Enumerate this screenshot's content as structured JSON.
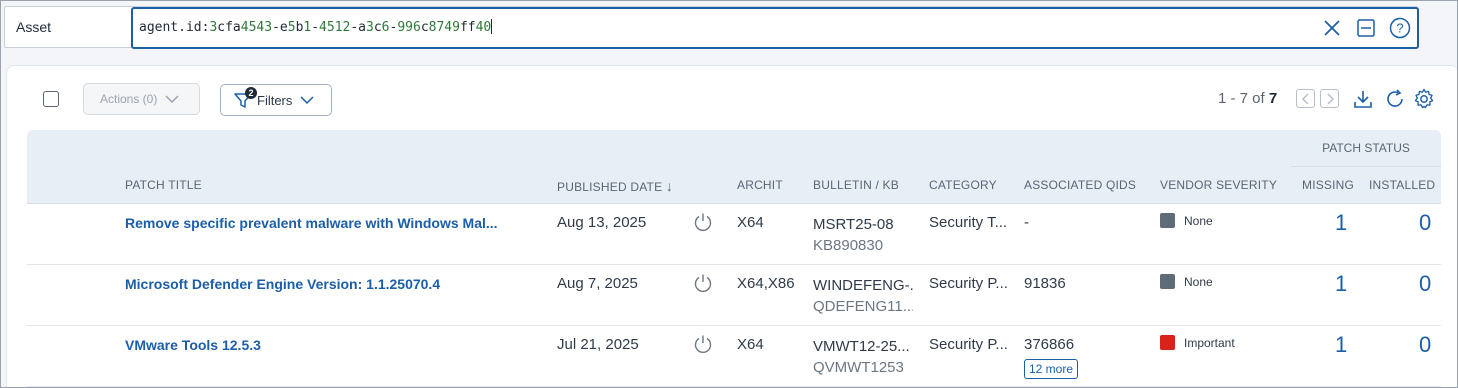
{
  "search": {
    "label": "Asset",
    "query_key": "agent.id:",
    "query_parts": [
      {
        "t": "3",
        "n": true
      },
      {
        "t": "cfa",
        "n": false
      },
      {
        "t": "4543",
        "n": true
      },
      {
        "t": "-e",
        "n": false
      },
      {
        "t": "5",
        "n": true
      },
      {
        "t": "b",
        "n": false
      },
      {
        "t": "1",
        "n": true
      },
      {
        "t": "-",
        "n": false
      },
      {
        "t": "4512",
        "n": true
      },
      {
        "t": "-a",
        "n": false
      },
      {
        "t": "3",
        "n": true
      },
      {
        "t": "c",
        "n": false
      },
      {
        "t": "6",
        "n": true
      },
      {
        "t": "-",
        "n": false
      },
      {
        "t": "996",
        "n": true
      },
      {
        "t": "c",
        "n": false
      },
      {
        "t": "8749",
        "n": true
      },
      {
        "t": "ff",
        "n": false
      },
      {
        "t": "40",
        "n": true
      }
    ],
    "icons": [
      "close-icon",
      "collapse-icon",
      "help-icon"
    ]
  },
  "toolbar": {
    "actions_label": "Actions (0)",
    "filters_label": "Filters",
    "filters_badge": "2",
    "pager_prefix": "1 - 7 of",
    "pager_total": "7"
  },
  "table": {
    "group_header": "PATCH STATUS",
    "headers": {
      "title": "PATCH TITLE",
      "published": "PUBLISHED DATE",
      "arch": "ARCHIT",
      "bulletin": "BULLETIN / KB",
      "category": "CATEGORY",
      "qids": "ASSOCIATED QIDS",
      "severity": "VENDOR SEVERITY",
      "missing": "MISSING",
      "installed": "INSTALLED"
    },
    "sort_indicator": "↓",
    "rows": [
      {
        "title": "Remove specific prevalent malware with Windows Mal...",
        "published": "Aug 13, 2025",
        "arch": "X64",
        "bulletin": "MSRT25-08",
        "kb": "KB890830",
        "category": "Security T...",
        "qids": "-",
        "more": "",
        "severity": "None",
        "severity_color": "#5f6b78",
        "missing": "1",
        "installed": "0"
      },
      {
        "title": "Microsoft Defender Engine Version: 1.1.25070.4",
        "published": "Aug 7, 2025",
        "arch": "X64,X86",
        "bulletin": "WINDEFENG-...",
        "kb": "QDEFENG11...",
        "category": "Security P...",
        "qids": "91836",
        "more": "",
        "severity": "None",
        "severity_color": "#5f6b78",
        "missing": "1",
        "installed": "0"
      },
      {
        "title": "VMware Tools 12.5.3",
        "published": "Jul 21, 2025",
        "arch": "X64",
        "bulletin": "VMWT12-25...",
        "kb": "QVMWT1253",
        "category": "Security P...",
        "qids": "376866",
        "more": "12 more",
        "severity": "Important",
        "severity_color": "#d9221a",
        "missing": "1",
        "installed": "0"
      }
    ]
  }
}
